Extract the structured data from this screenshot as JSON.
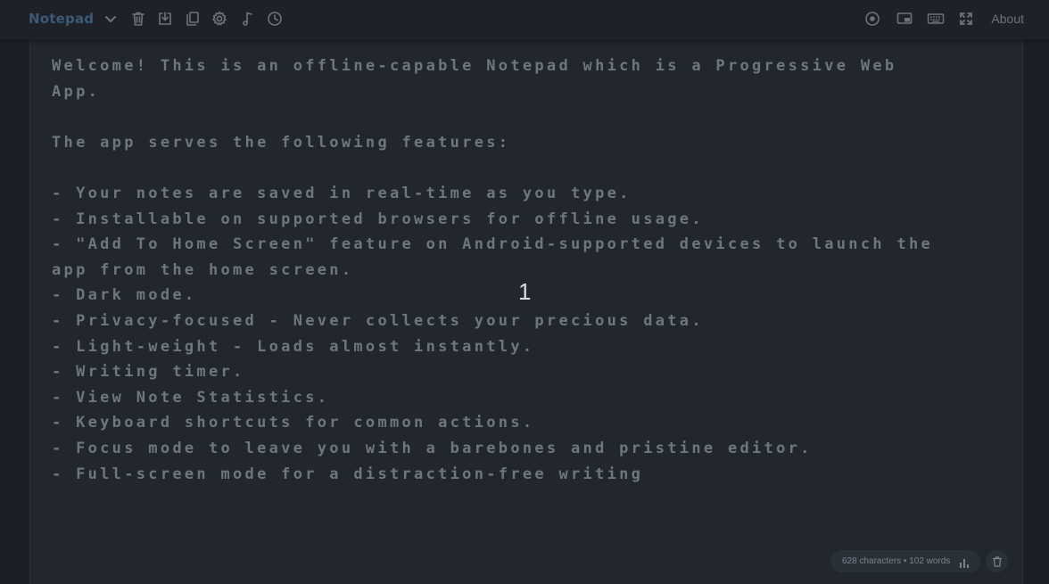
{
  "header": {
    "brand": "Notepad",
    "about_label": "About"
  },
  "toolbar_icons": [
    "chevron-down-icon",
    "trash-icon",
    "download-icon",
    "copy-icon",
    "gear-icon",
    "music-note-icon",
    "clock-icon",
    "focus-mode-icon",
    "display-mode-icon",
    "keyboard-icon",
    "fullscreen-icon"
  ],
  "editor": {
    "content": "Welcome! This is an offline-capable Notepad which is a Progressive Web App.\n\nThe app serves the following features:\n\n- Your notes are saved in real-time as you type.\n- Installable on supported browsers for offline usage.\n- \"Add To Home Screen\" feature on Android-supported devices to launch the app from the home screen.\n- Dark mode.\n- Privacy-focused - Never collects your precious data.\n- Light-weight - Loads almost instantly.\n- Writing timer.\n- View Note Statistics.\n- Keyboard shortcuts for common actions.\n- Focus mode to leave you with a barebones and pristine editor.\n- Full-screen mode for a distraction-free writing",
    "cursor_glyph": "1"
  },
  "footer": {
    "stats": "628 characters • 102 words"
  },
  "colors": {
    "background": "#1c2026",
    "editor_bg": "#22272e",
    "brand": "#3d5a75",
    "text": "#6f767f",
    "icon": "#6c737d"
  }
}
